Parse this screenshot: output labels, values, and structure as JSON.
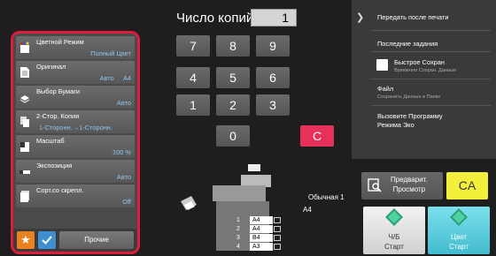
{
  "menu": [
    {
      "label": "Цветной Режим",
      "value": "Полный Цвет",
      "icon": "color-mode-icon"
    },
    {
      "label": "Оригинал",
      "value": "Авто     A4",
      "icon": "original-icon"
    },
    {
      "label": "Выбор Бумаги",
      "value": "Авто",
      "icon": "paper-select-icon"
    },
    {
      "label": "2-Стор. Копия",
      "value": "1-Сторонн.→1-Сторонн.",
      "icon": "duplex-icon"
    },
    {
      "label": "Масштаб",
      "value": "100 %",
      "icon": "zoom-icon"
    },
    {
      "label": "Экспозиция",
      "value": "Авто",
      "icon": "exposure-icon"
    },
    {
      "label": "Сорт.со скрепл.",
      "value": "Off",
      "icon": "sort-staple-icon"
    }
  ],
  "bottom": {
    "other_label": "Прочие"
  },
  "copies": {
    "label": "Число копий",
    "value": "1"
  },
  "keypad": {
    "k7": "7",
    "k8": "8",
    "k9": "9",
    "k4": "4",
    "k5": "5",
    "k6": "6",
    "k1": "1",
    "k2": "2",
    "k3": "3",
    "k0": "0",
    "clear": "C"
  },
  "right_panel": {
    "send_after_print": "Передать после печати",
    "recent_jobs": "Последние задания",
    "quick_save": "Быстрое Сохран",
    "quick_save_sub": "Временно Сохран. Данные",
    "file": "Файл",
    "file_sub": "Сохранить Данные в Папке",
    "eco_call_line1": "Вызовите Программу",
    "eco_call_line2": "Режима Эко"
  },
  "status": {
    "paper_type": "Обычная 1",
    "paper_size": "A4",
    "trays": [
      {
        "num": "1",
        "size": "A4"
      },
      {
        "num": "2",
        "size": "A4"
      },
      {
        "num": "3",
        "size": "B4"
      },
      {
        "num": "4",
        "size": "A3"
      }
    ]
  },
  "actions": {
    "preview_line1": "Предварит.",
    "preview_line2": "Просмотр",
    "ca": "CA",
    "bw_line1": "Ч/Б",
    "bw_line2": "Старт",
    "color_line1": "Цвет",
    "color_line2": "Старт"
  },
  "colors": {
    "highlight": "#e01c3c",
    "value_text": "#8fc6ef",
    "clear_key": "#e8315a",
    "ca": "#f2f03a",
    "color_start": "#42bccf"
  }
}
